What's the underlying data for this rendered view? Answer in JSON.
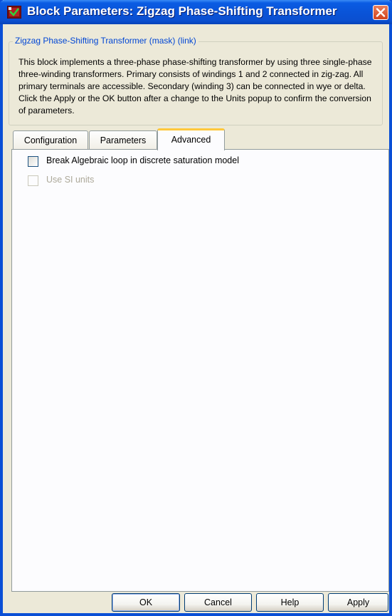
{
  "window": {
    "title": "Block Parameters: Zigzag Phase-Shifting Transformer"
  },
  "mask": {
    "group_label": "Zigzag Phase-Shifting Transformer (mask) (link)",
    "description": "This block implements a three-phase phase-shifting transformer by using three single-phase three-winding transformers. Primary consists of windings 1 and 2 connected in zig-zag. All primary terminals are accessible. Secondary (winding 3) can be connected in wye or delta. Click the Apply or the OK button after a change to the Units popup to confirm the conversion of parameters."
  },
  "tabs": [
    {
      "label": "Configuration",
      "active": false
    },
    {
      "label": "Parameters",
      "active": false
    },
    {
      "label": "Advanced",
      "active": true
    }
  ],
  "advanced": {
    "checkboxes": [
      {
        "label": "Break Algebraic loop in discrete saturation model",
        "checked": false,
        "enabled": true
      },
      {
        "label": "Use SI units",
        "checked": false,
        "enabled": false
      }
    ]
  },
  "buttons": {
    "ok": "OK",
    "cancel": "Cancel",
    "help": "Help",
    "apply": "Apply"
  },
  "icons": {
    "app": "simulink-block-icon",
    "close": "close-icon"
  },
  "colors": {
    "titlebar": "#0a54d8",
    "group_label": "#0046d5",
    "active_tab_highlight": "#ffc83c",
    "close_button": "#d2431c"
  }
}
